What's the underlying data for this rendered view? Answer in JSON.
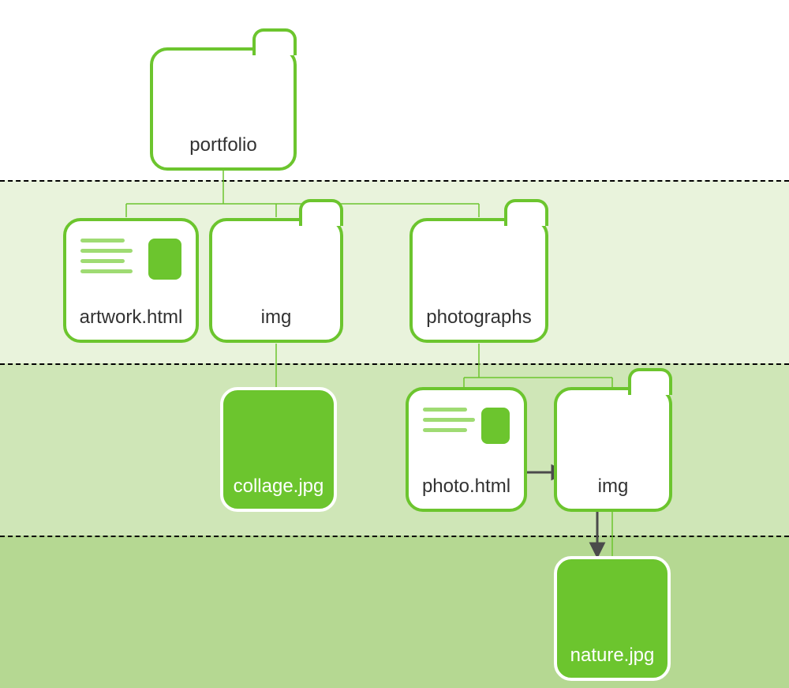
{
  "colors": {
    "brand_green": "#6cc52e",
    "band1": "#e9f3dc",
    "band2": "#cfe6b7",
    "band3": "#b5d892"
  },
  "nodes": {
    "root": {
      "label": "portfolio",
      "type": "folder"
    },
    "artwork": {
      "label": "artwork.html",
      "type": "html"
    },
    "img1": {
      "label": "img",
      "type": "folder"
    },
    "photographs": {
      "label": "photographs",
      "type": "folder"
    },
    "collage": {
      "label": "collage.jpg",
      "type": "image"
    },
    "photo": {
      "label": "photo.html",
      "type": "html"
    },
    "img2": {
      "label": "img",
      "type": "folder"
    },
    "nature": {
      "label": "nature.jpg",
      "type": "image"
    }
  },
  "hierarchy": {
    "portfolio": [
      "artwork.html",
      "img",
      "photographs"
    ],
    "img": [
      "collage.jpg"
    ],
    "photographs": [
      "photo.html",
      "img"
    ],
    "photographs/img": [
      "nature.jpg"
    ]
  },
  "arrows": [
    {
      "from": "photo.html",
      "to": "img"
    },
    {
      "from": "img",
      "to": "nature.jpg"
    }
  ]
}
